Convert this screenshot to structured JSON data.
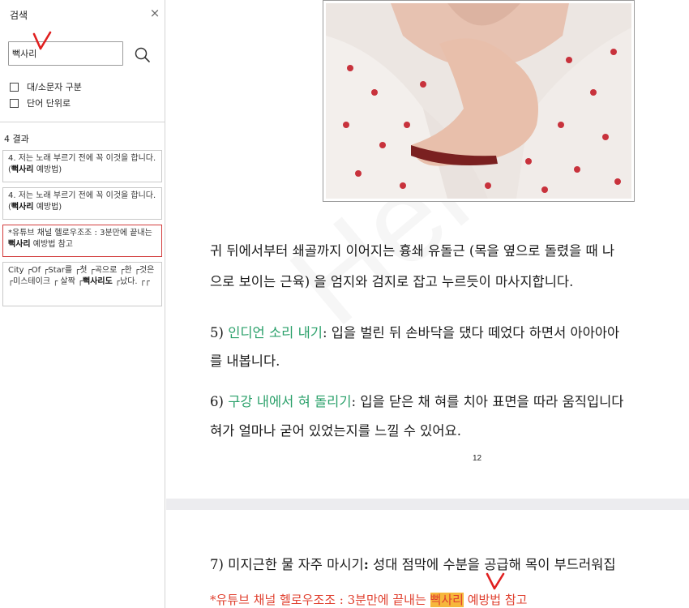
{
  "search_panel": {
    "title": "검색",
    "close_glyph": "×",
    "query": "뻑사리",
    "options": [
      {
        "label": "대/소문자 구분",
        "checked": false
      },
      {
        "label": "단어 단위로",
        "checked": false
      }
    ],
    "results_count": "4 결과",
    "results": [
      {
        "pre": "4. 저는 노래 부르기 전에 꼭 이것을 합니다. (",
        "match": "뻑사리",
        "post": " 예방법)"
      },
      {
        "pre": "4. 저는 노래 부르기 전에 꼭 이것을 합니다. (",
        "match": "뻑사리",
        "post": " 예방법)"
      },
      {
        "pre": "*유튜브 채널 헬로우조조 : 3분만에 끝내는 ",
        "match": "뻑사리",
        "post": " 예방법 참고"
      },
      {
        "pre": "City ┌Of ┌Star를 ┌첫 ┌곡으로 ┌한 ┌것은 ┌미스테이크 ┌ 살짝 ┌",
        "match": "뻑사리도",
        "post": " ┌났다. ┌┌"
      }
    ]
  },
  "document": {
    "para_a": [
      "귀 뒤에서부터 쇄골까지 이어지는 흉쇄 유돌근 (목을 옆으로 돌렸을 때 나",
      "으로 보이는 근육) 을 엄지와 검지로 잡고 누르듯이 마사지합니다."
    ],
    "item5": {
      "num": "5) ",
      "title": "인디언 소리 내기",
      "text": ": 입을 벌린 뒤 손바닥을 댔다 떼었다 하면서 아아아아",
      "cont": "를 내봅니다."
    },
    "item6": {
      "num": "6) ",
      "title": "구강 내에서 혀 돌리기",
      "text": ": 입을 닫은 채 혀를 치아 표면을 따라 움직입니다",
      "cont": "혀가 얼마나 굳어 있었는지를 느낄 수 있어요."
    },
    "page_number": "12",
    "item7": {
      "text": "7) 미지근한 물 자주 마시기",
      "colon": ":",
      "rest": " 성대 점막에 수분을 공급해 목이 부드러워집"
    },
    "note": {
      "pre": "*유튜브 채널 헬로우조조 : 3분만에 끝내는 ",
      "match": "뻑사리",
      "post": " 예방법 참고"
    }
  },
  "colors": {
    "accent_green": "#2aa06a",
    "note_red": "#e0402f",
    "highlight": "#f6b73c",
    "active_border": "#d23c3c"
  },
  "icons": {
    "search": "search-icon",
    "close": "close-icon",
    "marker": "red-check-mark"
  }
}
